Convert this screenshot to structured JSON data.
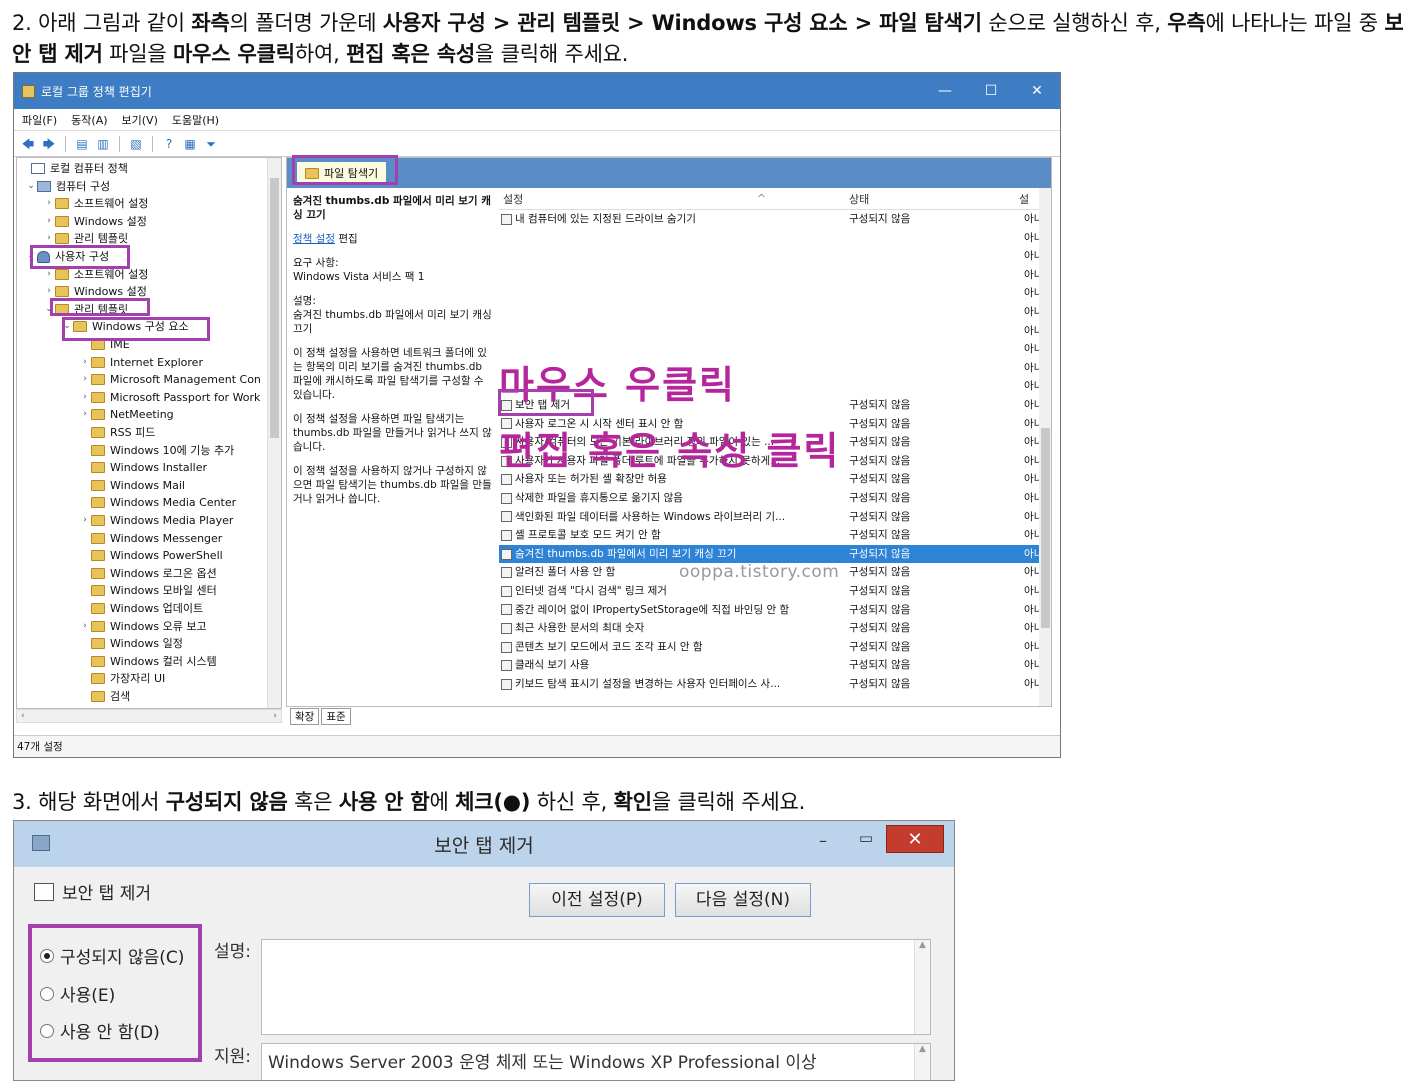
{
  "step2": {
    "p1": "2. 아래 그림과 같이 ",
    "b1": "좌측",
    "p2": "의 폴더명 가운데 ",
    "b2": "사용자 구성 > 관리 템플릿 > Windows 구성 요소 > 파일 탐색기",
    "p3": " 순으로 실행하신 후, ",
    "b3": "우측",
    "p4": "에 나타나는 파일 중 ",
    "b4": "보안 탭 제거",
    "p5": " 파일을 ",
    "b5": "마우스 우클릭",
    "p6": "하여, ",
    "b6": "편집 혹은 속성",
    "p7": "을 클릭해 주세요."
  },
  "step3": {
    "p1": "3. 해당 화면에서 ",
    "b1": "구성되지 않음",
    "p2": " 혹은 ",
    "b2": "사용 안 함",
    "p3": "에 ",
    "b3": "체크(●)",
    "p4": " 하신 후, ",
    "b4": "확인",
    "p5": "을 클릭해 주세요."
  },
  "gpe": {
    "title": "로컬 그룹 정책 편집기",
    "window_buttons": {
      "minimize": "—",
      "maximize": "☐",
      "close": "✕"
    },
    "menu": [
      "파일(F)",
      "동작(A)",
      "보기(V)",
      "도움말(H)"
    ],
    "tree": [
      {
        "label": "로컬 컴퓨터 정책",
        "exp": "",
        "icon": "doc"
      },
      {
        "label": "컴퓨터 구성",
        "exp": "⌄",
        "icon": "pc"
      },
      {
        "label": "소프트웨어 설정",
        "exp": "›",
        "icon": "folder"
      },
      {
        "label": "Windows 설정",
        "exp": "›",
        "icon": "folder"
      },
      {
        "label": "관리 템플릿",
        "exp": "›",
        "icon": "folder"
      },
      {
        "label": "사용자 구성",
        "exp": "⌄",
        "icon": "user"
      },
      {
        "label": "소프트웨어 설정",
        "exp": "›",
        "icon": "folder"
      },
      {
        "label": "Windows 설정",
        "exp": "›",
        "icon": "folder"
      },
      {
        "label": "관리 템플릿",
        "exp": "⌄",
        "icon": "folder"
      },
      {
        "label": "Windows 구성 요소",
        "exp": "⌄",
        "icon": "folder"
      },
      {
        "label": "IME",
        "exp": "",
        "icon": "folder"
      },
      {
        "label": "Internet Explorer",
        "exp": "›",
        "icon": "folder"
      },
      {
        "label": "Microsoft Management Con",
        "exp": "›",
        "icon": "folder"
      },
      {
        "label": "Microsoft Passport for Work",
        "exp": "›",
        "icon": "folder"
      },
      {
        "label": "NetMeeting",
        "exp": "›",
        "icon": "folder"
      },
      {
        "label": "RSS 피드",
        "exp": "",
        "icon": "folder"
      },
      {
        "label": "Windows 10에 기능 추가",
        "exp": "",
        "icon": "folder"
      },
      {
        "label": "Windows Installer",
        "exp": "",
        "icon": "folder"
      },
      {
        "label": "Windows Mail",
        "exp": "",
        "icon": "folder"
      },
      {
        "label": "Windows Media Center",
        "exp": "",
        "icon": "folder"
      },
      {
        "label": "Windows Media Player",
        "exp": "›",
        "icon": "folder"
      },
      {
        "label": "Windows Messenger",
        "exp": "",
        "icon": "folder"
      },
      {
        "label": "Windows PowerShell",
        "exp": "",
        "icon": "folder"
      },
      {
        "label": "Windows 로그온 옵션",
        "exp": "",
        "icon": "folder"
      },
      {
        "label": "Windows 모바일 센터",
        "exp": "",
        "icon": "folder"
      },
      {
        "label": "Windows 업데이트",
        "exp": "",
        "icon": "folder"
      },
      {
        "label": "Windows 오류 보고",
        "exp": "›",
        "icon": "folder"
      },
      {
        "label": "Windows 일정",
        "exp": "",
        "icon": "folder"
      },
      {
        "label": "Windows 컬러 시스템",
        "exp": "",
        "icon": "folder"
      },
      {
        "label": "가장자리 UI",
        "exp": "",
        "icon": "folder"
      },
      {
        "label": "검색",
        "exp": "",
        "icon": "folder"
      }
    ],
    "header_folder": "파일 탐색기",
    "desc": {
      "title": "숨겨진 thumbs.db 파일에서 미리 보기 캐싱 끄기",
      "edit_link": "정책 설정",
      "edit_suffix": " 편집",
      "req_label": "요구 사항:",
      "req_value": "Windows Vista 서비스 팩 1",
      "desc_label": "설명:",
      "desc_title": "숨겨진 thumbs.db 파일에서 미리 보기 캐싱 끄기",
      "para1": "이 정책 설정을 사용하면 네트워크 폴더에 있는 항목의 미리 보기를 숨겨진 thumbs.db 파일에 캐시하도록 파일 탐색기를 구성할 수 있습니다.",
      "para2": "이 정책 설정을 사용하면 파일 탐색기는 thumbs.db 파일을 만들거나 읽거나 쓰지 않습니다.",
      "para3": "이 정책 설정을 사용하지 않거나 구성하지 않으면 파일 탐색기는 thumbs.db 파일을 만들거나 읽거나 씁니다."
    },
    "list_header": {
      "setting": "설정",
      "state": "상태",
      "comment": "설"
    },
    "rows_top": [
      {
        "name": "내 컴퓨터에 있는 지정된 드라이브 숨기기",
        "state": "구성되지 않음",
        "c": "아니"
      }
    ],
    "blank_rows": [
      "아니",
      "아니",
      "아니",
      "아니",
      "아니",
      "아니",
      "아니",
      "아니",
      "아니"
    ],
    "rows": [
      {
        "name": "보안 탭 제거",
        "state": "구성되지 않음",
        "c": "아니"
      },
      {
        "name": "사용자 로그온 시 시작 센터 표시 안 함",
        "state": "구성되지 않음",
        "c": "아니"
      },
      {
        "name": "사용자/컴퓨터의 모든 기본 라이브러리 정의 파일이 있는 ...",
        "state": "구성되지 않음",
        "c": "아니"
      },
      {
        "name": "사용자가 사용자 파일 폴더 루트에 파일을 추가하지 못하게...",
        "state": "구성되지 않음",
        "c": "아니"
      },
      {
        "name": "사용자 또는 허가된 셸 확장만 허용",
        "state": "구성되지 않음",
        "c": "아니"
      },
      {
        "name": "삭제한 파일을 휴지통으로 옮기지 않음",
        "state": "구성되지 않음",
        "c": "아니"
      },
      {
        "name": "색인화된 파일 데이터를 사용하는 Windows 라이브러리 기...",
        "state": "구성되지 않음",
        "c": "아니"
      },
      {
        "name": "셸 프로토콜 보호 모드 켜기 안 함",
        "state": "구성되지 않음",
        "c": "아니"
      },
      {
        "name": "숨겨진 thumbs.db 파일에서 미리 보기 캐싱 끄기",
        "state": "구성되지 않음",
        "c": "아니",
        "selected": true
      },
      {
        "name": "알려진 폴더 사용 안 함",
        "state": "구성되지 않음",
        "c": "아니"
      },
      {
        "name": "인터넷 검색 \"다시 검색\" 링크 제거",
        "state": "구성되지 않음",
        "c": "아니"
      },
      {
        "name": "중간 레이어 없이 IPropertySetStorage에 직접 바인딩 안 함",
        "state": "구성되지 않음",
        "c": "아니"
      },
      {
        "name": "최근 사용한 문서의 최대 숫자",
        "state": "구성되지 않음",
        "c": "아니"
      },
      {
        "name": "콘텐츠 보기 모드에서 코드 조각 표시 안 함",
        "state": "구성되지 않음",
        "c": "아니"
      },
      {
        "name": "클래식 보기 사용",
        "state": "구성되지 않음",
        "c": "아니"
      },
      {
        "name": "키보드 탐색 표시기 설정을 변경하는 사용자 인터페이스 사...",
        "state": "구성되지 않음",
        "c": "아니"
      }
    ],
    "overlay_line1": "마우스 우클릭",
    "overlay_line2": "편집 혹은 속성 클릭",
    "watermark": "ooppa.tistory.com",
    "tabs": [
      "확장",
      "표준"
    ],
    "status": "47개 설정"
  },
  "dialog": {
    "title": "보안 탭 제거",
    "policy_name": "보안 탭 제거",
    "prev_button": "이전 설정(P)",
    "next_button": "다음 설정(N)",
    "radio_not_configured": "구성되지 않음(C)",
    "radio_enabled": "사용(E)",
    "radio_disabled": "사용 안 함(D)",
    "comment_label": "설명:",
    "support_label": "지원:",
    "support_value": "Windows Server 2003 운영 체제 또는 Windows XP Professional 이상",
    "window_buttons": {
      "minimize": "–",
      "maximize": "▭",
      "close": "✕"
    }
  },
  "colors": {
    "highlight": "#a43fae",
    "overlay_text": "#b5269b",
    "selection": "#2f83d6",
    "title_blue": "#3e7dc4"
  }
}
